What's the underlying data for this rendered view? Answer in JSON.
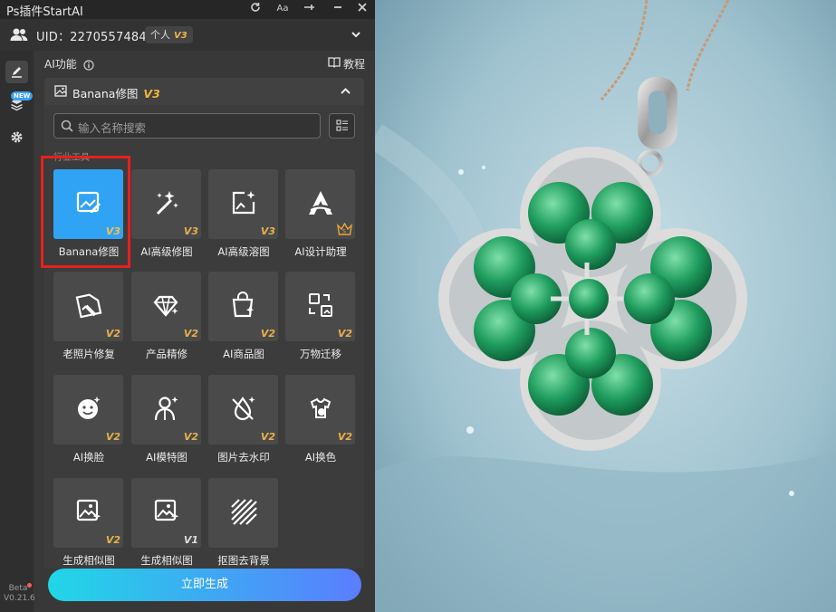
{
  "window": {
    "title": "Ps插件StartAI"
  },
  "user": {
    "uid": "UID：2270557484",
    "plan": "个人",
    "plan_version": "V3"
  },
  "sidebar": {
    "new_badge": "NEW",
    "beta": "Beta",
    "version": "V0.21.6"
  },
  "section": {
    "title": "AI功能",
    "tutorial": "教程"
  },
  "accordion": {
    "label": "Banana修图",
    "version": "V3"
  },
  "search": {
    "placeholder": "输入名称搜索"
  },
  "category": "行业工具",
  "tools": [
    {
      "label": "Banana修图",
      "badge": "V3",
      "icon": "image-edit-icon"
    },
    {
      "label": "AI高级修图",
      "badge": "V3",
      "icon": "magic-wand-icon"
    },
    {
      "label": "AI高级溶图",
      "badge": "V3",
      "icon": "image-blend-icon"
    },
    {
      "label": "AI设计助理",
      "badge": "",
      "icon": "design-assistant-icon"
    },
    {
      "label": "老照片修复",
      "badge": "V2",
      "icon": "photo-repair-icon"
    },
    {
      "label": "产品精修",
      "badge": "V2",
      "icon": "diamond-icon"
    },
    {
      "label": "AI商品图",
      "badge": "V2",
      "icon": "shopping-bag-icon"
    },
    {
      "label": "万物迁移",
      "badge": "V2",
      "icon": "transfer-icon"
    },
    {
      "label": "AI换脸",
      "badge": "V2",
      "icon": "face-icon"
    },
    {
      "label": "AI模特图",
      "badge": "V2",
      "icon": "model-icon"
    },
    {
      "label": "图片去水印",
      "badge": "V2",
      "icon": "remove-watermark-icon"
    },
    {
      "label": "AI换色",
      "badge": "V2",
      "icon": "palette-icon"
    },
    {
      "label": "生成相似图",
      "badge": "V2",
      "icon": "similar-image-icon"
    },
    {
      "label": "生成相似图",
      "badge": "V1",
      "icon": "similar-image-icon"
    },
    {
      "label": "抠图去背景",
      "badge": "",
      "icon": "hatch-background-icon"
    }
  ],
  "generate_button": "立即生成",
  "colors": {
    "accent": "#31a3f5",
    "badge": "#e6b04a",
    "highlight": "#e8201f",
    "button_start": "#20d7e6",
    "button_end": "#5a7dff"
  }
}
